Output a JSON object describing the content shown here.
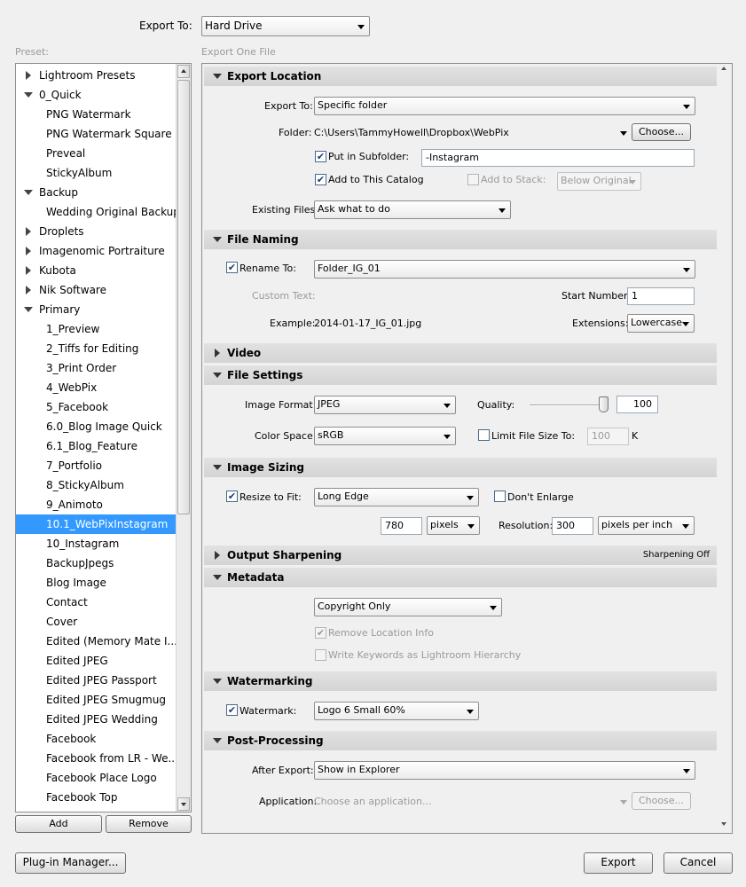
{
  "header": {
    "export_to_label": "Export To:",
    "export_to_value": "Hard Drive"
  },
  "preset_label": "Preset:",
  "export_panel_label": "Export One File",
  "presets": [
    {
      "label": "Lightroom Presets",
      "type": "folder",
      "expanded": false
    },
    {
      "label": "0_Quick",
      "type": "folder",
      "expanded": true
    },
    {
      "label": "PNG Watermark",
      "type": "child"
    },
    {
      "label": "PNG Watermark Square",
      "type": "child"
    },
    {
      "label": "Preveal",
      "type": "child"
    },
    {
      "label": "StickyAlbum",
      "type": "child"
    },
    {
      "label": "Backup",
      "type": "folder",
      "expanded": true
    },
    {
      "label": "Wedding Original Backup",
      "type": "child"
    },
    {
      "label": "Droplets",
      "type": "folder",
      "expanded": false
    },
    {
      "label": "Imagenomic Portraiture",
      "type": "folder",
      "expanded": false
    },
    {
      "label": "Kubota",
      "type": "folder",
      "expanded": false
    },
    {
      "label": "Nik Software",
      "type": "folder",
      "expanded": false
    },
    {
      "label": "Primary",
      "type": "folder",
      "expanded": true
    },
    {
      "label": "1_Preview",
      "type": "child"
    },
    {
      "label": "2_Tiffs for Editing",
      "type": "child"
    },
    {
      "label": "3_Print Order",
      "type": "child"
    },
    {
      "label": "4_WebPix",
      "type": "child"
    },
    {
      "label": "5_Facebook",
      "type": "child"
    },
    {
      "label": "6.0_Blog Image Quick",
      "type": "child"
    },
    {
      "label": "6.1_Blog_Feature",
      "type": "child"
    },
    {
      "label": "7_Portfolio",
      "type": "child"
    },
    {
      "label": "8_StickyAlbum",
      "type": "child"
    },
    {
      "label": "9_Animoto",
      "type": "child"
    },
    {
      "label": "10.1_WebPixInstagram",
      "type": "child",
      "selected": true
    },
    {
      "label": "10_Instagram",
      "type": "child"
    },
    {
      "label": "BackupJpegs",
      "type": "child"
    },
    {
      "label": "Blog Image",
      "type": "child"
    },
    {
      "label": "Contact",
      "type": "child"
    },
    {
      "label": "Cover",
      "type": "child"
    },
    {
      "label": "Edited (Memory Mate I...",
      "type": "child"
    },
    {
      "label": "Edited JPEG",
      "type": "child"
    },
    {
      "label": "Edited JPEG Passport",
      "type": "child"
    },
    {
      "label": "Edited JPEG Smugmug",
      "type": "child"
    },
    {
      "label": "Edited JPEG Wedding",
      "type": "child"
    },
    {
      "label": "Facebook",
      "type": "child"
    },
    {
      "label": "Facebook from LR - We...",
      "type": "child"
    },
    {
      "label": "Facebook Place Logo",
      "type": "child"
    },
    {
      "label": "Facebook Top",
      "type": "child"
    }
  ],
  "preset_buttons": {
    "add": "Add",
    "remove": "Remove"
  },
  "export_location": {
    "title": "Export Location",
    "export_to_label": "Export To:",
    "export_to_value": "Specific folder",
    "folder_label": "Folder:",
    "folder_value": "C:\\Users\\TammyHowell\\Dropbox\\WebPix",
    "choose": "Choose...",
    "subfolder_label": "Put in Subfolder:",
    "subfolder_value": "-Instagram",
    "add_catalog_label": "Add to This Catalog",
    "add_stack_label": "Add to Stack:",
    "stack_value": "Below Original",
    "existing_label": "Existing Files:",
    "existing_value": "Ask what to do"
  },
  "file_naming": {
    "title": "File Naming",
    "rename_label": "Rename To:",
    "rename_value": "Folder_IG_01",
    "custom_text_label": "Custom Text:",
    "start_number_label": "Start Number:",
    "start_number_value": "1",
    "example_label": "Example:",
    "example_value": "2014-01-17_IG_01.jpg",
    "extensions_label": "Extensions:",
    "extensions_value": "Lowercase"
  },
  "video": {
    "title": "Video"
  },
  "file_settings": {
    "title": "File Settings",
    "format_label": "Image Format:",
    "format_value": "JPEG",
    "quality_label": "Quality:",
    "quality_value": "100",
    "quality_fraction": 1.0,
    "color_space_label": "Color Space:",
    "color_space_value": "sRGB",
    "limit_label": "Limit File Size To:",
    "limit_value": "100",
    "limit_unit": "K"
  },
  "image_sizing": {
    "title": "Image Sizing",
    "resize_label": "Resize to Fit:",
    "resize_value": "Long Edge",
    "dont_enlarge_label": "Don't Enlarge",
    "size_value": "780",
    "size_unit": "pixels",
    "resolution_label": "Resolution:",
    "resolution_value": "300",
    "resolution_unit": "pixels per inch"
  },
  "output_sharpening": {
    "title": "Output Sharpening",
    "note": "Sharpening Off"
  },
  "metadata": {
    "title": "Metadata",
    "value": "Copyright Only",
    "remove_location": "Remove Location Info",
    "write_keywords": "Write Keywords as Lightroom Hierarchy"
  },
  "watermarking": {
    "title": "Watermarking",
    "label": "Watermark:",
    "value": "Logo 6 Small 60%"
  },
  "post_processing": {
    "title": "Post-Processing",
    "after_label": "After Export:",
    "after_value": "Show in Explorer",
    "app_label": "Application:",
    "app_placeholder": "Choose an application...",
    "choose": "Choose..."
  },
  "footer": {
    "plugin_manager": "Plug-in Manager...",
    "export": "Export",
    "cancel": "Cancel"
  }
}
